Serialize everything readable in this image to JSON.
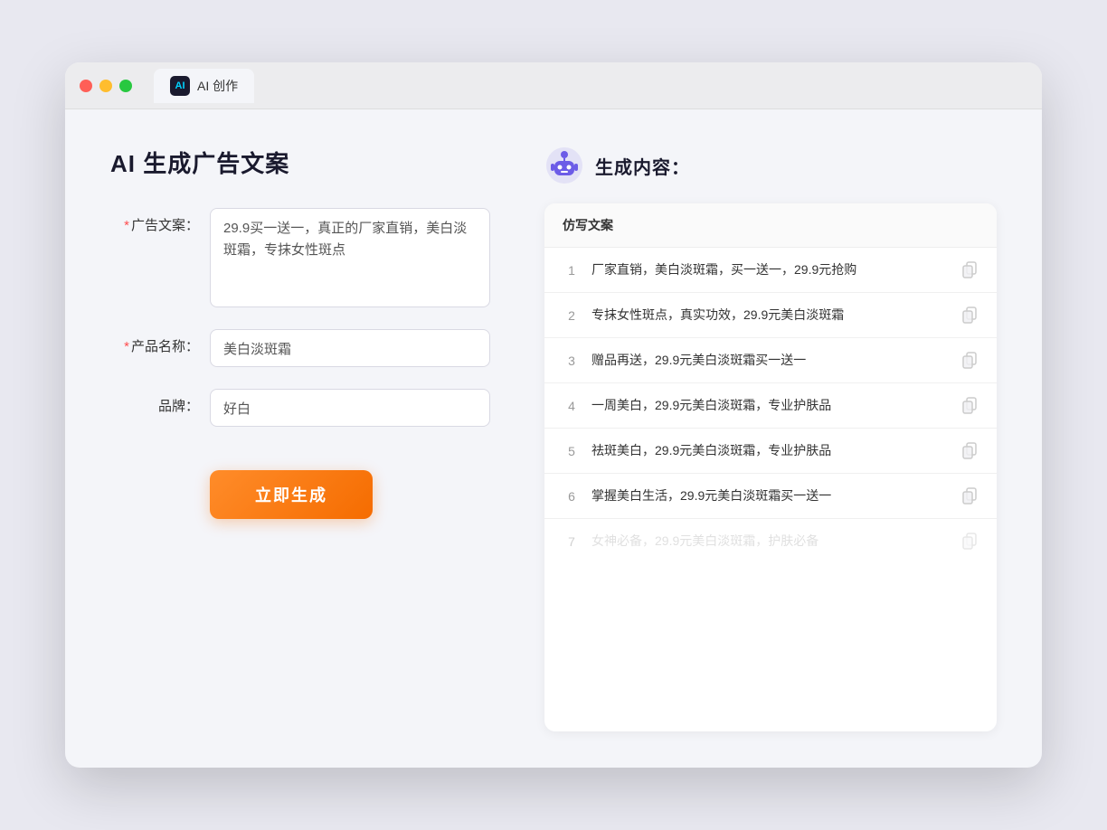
{
  "browser": {
    "tab_label": "AI 创作"
  },
  "page": {
    "title": "AI 生成广告文案",
    "right_title": "生成内容："
  },
  "form": {
    "ad_copy_label": "广告文案：",
    "ad_copy_required": "*",
    "ad_copy_value": "29.9买一送一，真正的厂家直销，美白淡斑霜，专抹女性斑点",
    "product_name_label": "产品名称：",
    "product_name_required": "*",
    "product_name_value": "美白淡斑霜",
    "brand_label": "品牌：",
    "brand_value": "好白",
    "generate_btn": "立即生成"
  },
  "results": {
    "column_header": "仿写文案",
    "items": [
      {
        "num": "1",
        "text": "厂家直销，美白淡斑霜，买一送一，29.9元抢购"
      },
      {
        "num": "2",
        "text": "专抹女性斑点，真实功效，29.9元美白淡斑霜"
      },
      {
        "num": "3",
        "text": "赠品再送，29.9元美白淡斑霜买一送一"
      },
      {
        "num": "4",
        "text": "一周美白，29.9元美白淡斑霜，专业护肤品"
      },
      {
        "num": "5",
        "text": "祛斑美白，29.9元美白淡斑霜，专业护肤品"
      },
      {
        "num": "6",
        "text": "掌握美白生活，29.9元美白淡斑霜买一送一"
      },
      {
        "num": "7",
        "text": "女神必备，29.9元美白淡斑霜，护肤必备",
        "faded": true
      }
    ]
  }
}
